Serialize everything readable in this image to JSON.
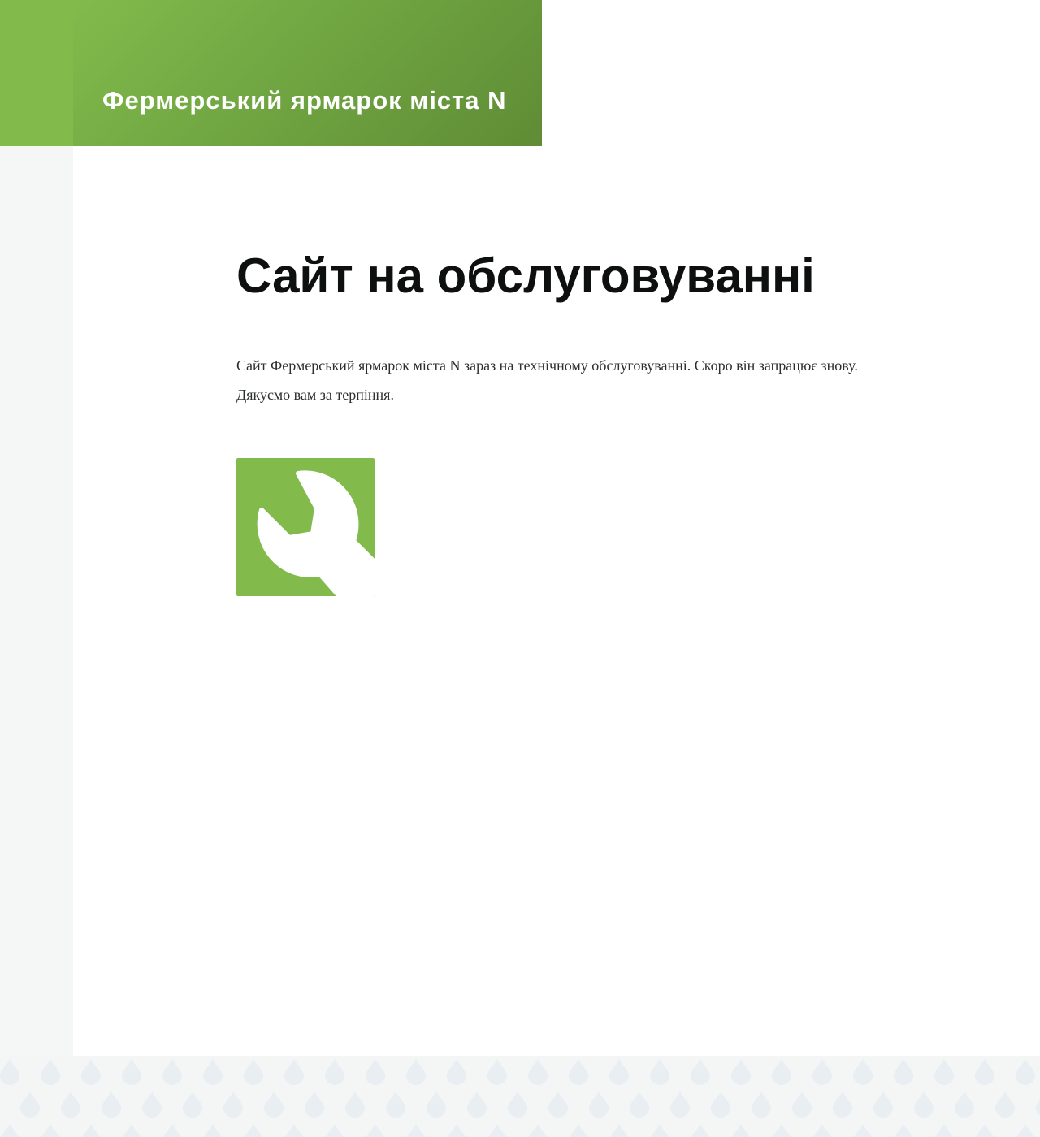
{
  "header": {
    "site_title": "Фермерський ярмарок міста N",
    "accent_color": "#82bb4c"
  },
  "main": {
    "title": "Сайт на обслуговуванні",
    "message_line1": "Сайт Фермерський ярмарок міста N зараз на технічному обслуговуванні. Скоро він запрацює знову.",
    "message_line2": "Дякуємо вам за терпіння.",
    "icon": "wrench-icon"
  },
  "footer": {
    "pattern_icon": "droplet-icon",
    "pattern_color": "#e8eef1"
  }
}
